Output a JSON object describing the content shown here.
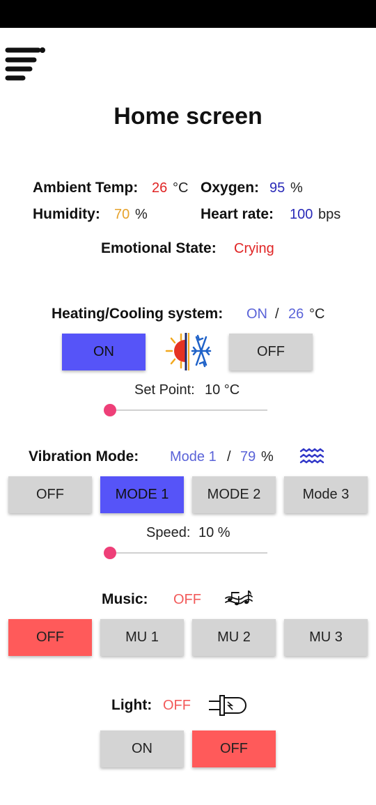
{
  "header": {
    "title": "Home screen",
    "menu_icon": "hamburger-menu-icon"
  },
  "vitals": {
    "ambient_temp": {
      "label": "Ambient Temp:",
      "value": "26",
      "unit": "°C"
    },
    "oxygen": {
      "label": "Oxygen:",
      "value": "95",
      "unit": "%"
    },
    "humidity": {
      "label": "Humidity:",
      "value": "70",
      "unit": "%"
    },
    "heart_rate": {
      "label": "Heart rate:",
      "value": "100",
      "unit": "bps"
    },
    "emotional_state": {
      "label": "Emotional State:",
      "value": "Crying"
    }
  },
  "heating": {
    "label": "Heating/Cooling system:",
    "status": "ON",
    "separator": "/",
    "temp": "26",
    "unit": "°C",
    "on_label": "ON",
    "off_label": "OFF",
    "icon": "heat-cool-icon",
    "setpoint_label": "Set Point:",
    "setpoint_value": "10 °C",
    "slider_fraction": 0
  },
  "vibration": {
    "label": "Vibration Mode:",
    "mode": "Mode 1",
    "separator": "/",
    "percent": "79",
    "unit": "%",
    "icon": "vibration-waves-icon",
    "buttons": [
      "OFF",
      "MODE 1",
      "MODE 2",
      "Mode 3"
    ],
    "active_index": 1,
    "speed_label": "Speed:",
    "speed_value": "10 %",
    "slider_fraction": 0
  },
  "music": {
    "label": "Music:",
    "status": "OFF",
    "icon": "music-notes-icon",
    "buttons": [
      "OFF",
      "MU 1",
      "MU 2",
      "MU 3"
    ],
    "active_index": 0
  },
  "light": {
    "label": "Light:",
    "status": "OFF",
    "icon": "led-bulb-icon",
    "on_label": "ON",
    "off_label": "OFF",
    "active": "OFF"
  },
  "colors": {
    "accent_blue": "#5654f8",
    "accent_red": "#ff5a5a",
    "slider_pink": "#ee3f78",
    "button_gray": "#d4d4d4"
  }
}
